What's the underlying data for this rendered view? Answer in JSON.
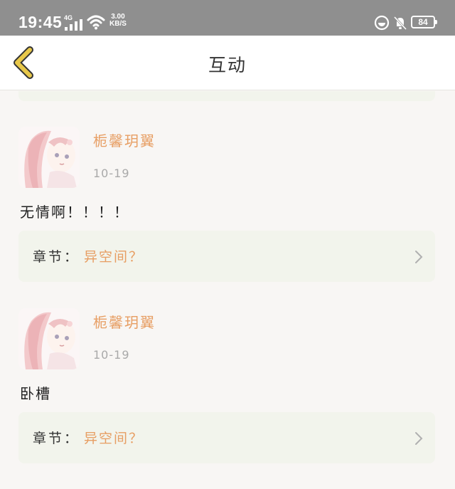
{
  "status_bar": {
    "time": "19:45",
    "network": "4G",
    "speed_value": "3.00",
    "speed_unit": "KB/S",
    "battery": "84",
    "icons": [
      "signal-icon",
      "wifi-icon",
      "focus-mode-icon",
      "mute-bell-icon",
      "battery-icon"
    ]
  },
  "header": {
    "title": "互动",
    "back_icon": "chevron-left-icon"
  },
  "colors": {
    "accent": "#e79e63",
    "back_arrow": "#e8c84a",
    "card_bg": "#f2f4ec",
    "page_bg": "#f8f6f4"
  },
  "comments": [
    {
      "username": "栀馨玥翼",
      "date": "10-19",
      "text": "无情啊！！！！",
      "chapter_label": "章节：",
      "chapter_name": "异空间？"
    },
    {
      "username": "栀馨玥翼",
      "date": "10-19",
      "text": "卧槽",
      "chapter_label": "章节：",
      "chapter_name": "异空间？"
    }
  ]
}
